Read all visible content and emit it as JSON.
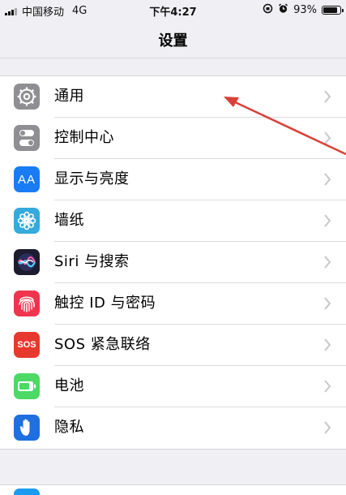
{
  "status_bar": {
    "carrier": "中国移动",
    "network": "4G",
    "time": "下午4:27",
    "battery": "93%",
    "battery_level": 0.93
  },
  "nav": {
    "title": "设置"
  },
  "settings": [
    {
      "label": "通用",
      "icon": "gear-icon",
      "color": "#8e8e93"
    },
    {
      "label": "控制中心",
      "icon": "toggles-icon",
      "color": "#8e8e93"
    },
    {
      "label": "显示与亮度",
      "icon": "text-size-icon",
      "color": "#1a7cf5"
    },
    {
      "label": "墙纸",
      "icon": "flower-icon",
      "color": "#35aadc"
    },
    {
      "label": "Siri 与搜索",
      "icon": "siri-icon",
      "color": "#1c1c2e"
    },
    {
      "label": "触控 ID 与密码",
      "icon": "fingerprint-icon",
      "color": "#f0344e"
    },
    {
      "label": "SOS 紧急联络",
      "icon": "sos-icon",
      "color": "#e8392e"
    },
    {
      "label": "电池",
      "icon": "battery-icon",
      "color": "#4cd964"
    },
    {
      "label": "隐私",
      "icon": "hand-icon",
      "color": "#1f6fe0"
    }
  ],
  "icon_text": {
    "aa": "AA",
    "sos": "SOS"
  },
  "annotation": {
    "arrow_color": "#d94137"
  }
}
